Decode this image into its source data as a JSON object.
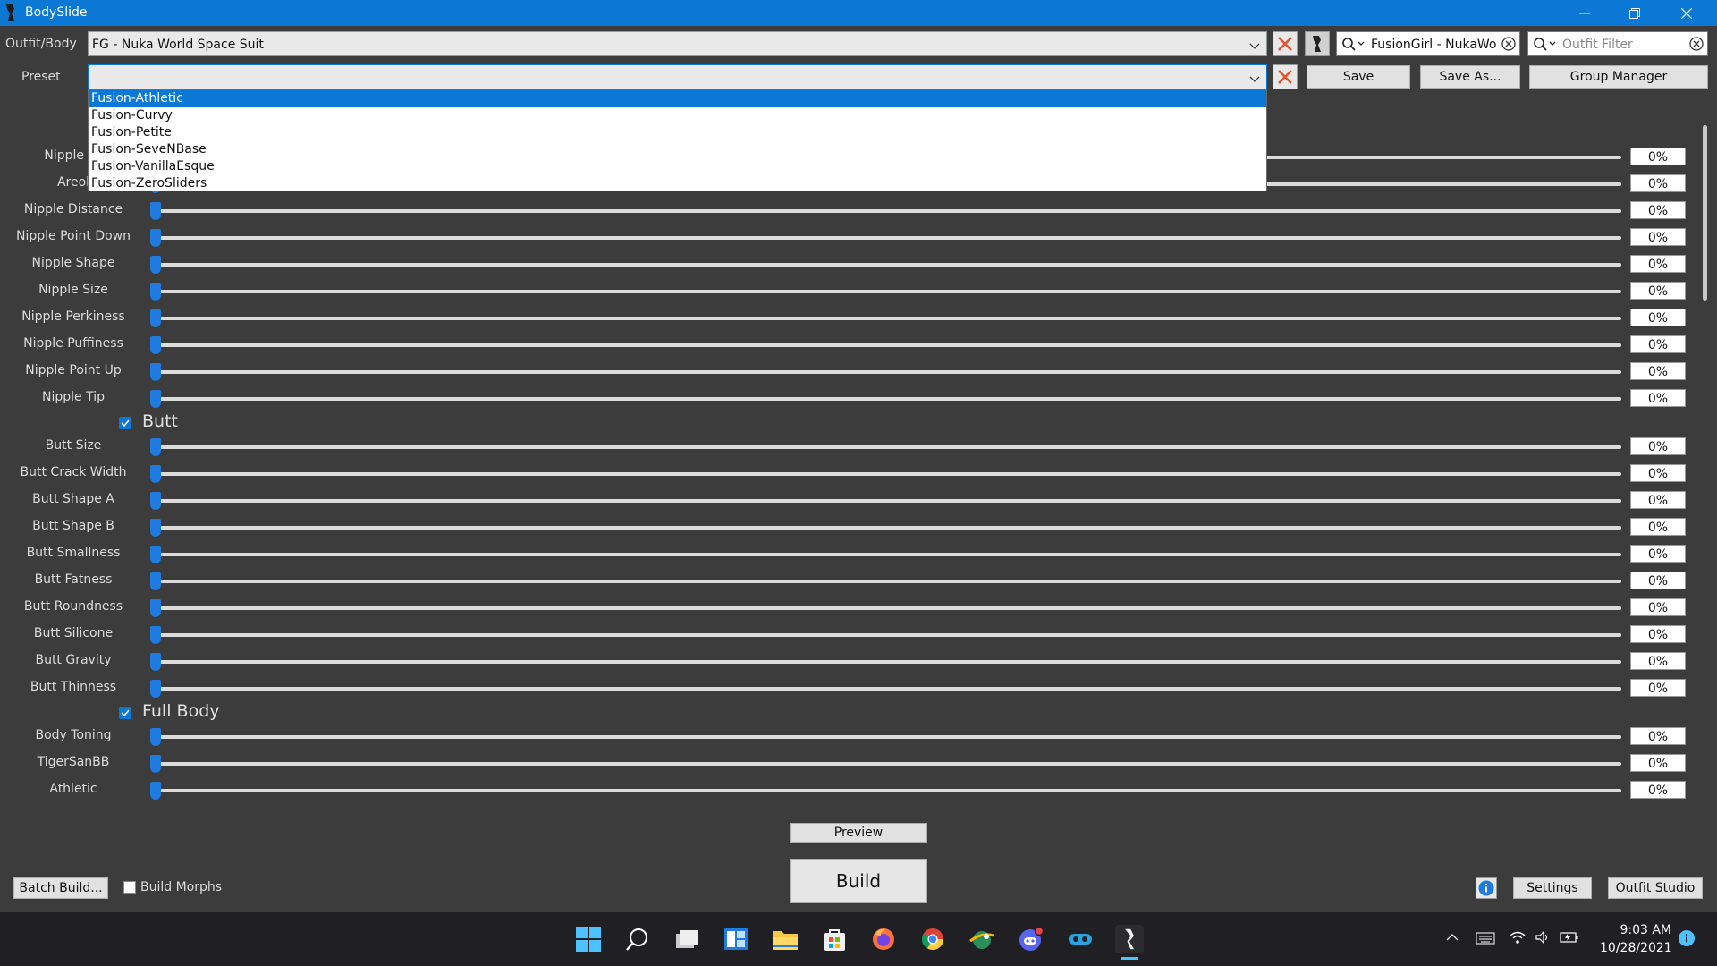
{
  "window": {
    "title": "BodySlide"
  },
  "outfit": {
    "label": "Outfit/Body",
    "value": "FG - Nuka World Space Suit",
    "group_filter": "FusionGirl - NukaWo",
    "outfit_filter_placeholder": "Outfit Filter"
  },
  "preset": {
    "label": "Preset",
    "value": "",
    "save_label": "Save",
    "save_as_label": "Save As...",
    "group_manager_label": "Group Manager",
    "options": [
      "Fusion-Athletic",
      "Fusion-Curvy",
      "Fusion-Petite",
      "Fusion-SeveNBase",
      "Fusion-VanillaEsque",
      "Fusion-ZeroSliders"
    ],
    "selected_index": 0
  },
  "sliders": {
    "partial_rows": [
      {
        "name": "Nipple Le",
        "value": "0%"
      },
      {
        "name": "Areol",
        "value": "0%"
      }
    ],
    "nipple": [
      {
        "name": "Nipple Distance",
        "value": "0%"
      },
      {
        "name": "Nipple Point Down",
        "value": "0%"
      },
      {
        "name": "Nipple Shape",
        "value": "0%"
      },
      {
        "name": "Nipple Size",
        "value": "0%"
      },
      {
        "name": "Nipple Perkiness",
        "value": "0%"
      },
      {
        "name": "Nipple Puffiness",
        "value": "0%"
      },
      {
        "name": "Nipple Point Up",
        "value": "0%"
      },
      {
        "name": "Nipple Tip",
        "value": "0%"
      }
    ],
    "butt_group": "Butt",
    "butt": [
      {
        "name": "Butt Size",
        "value": "0%"
      },
      {
        "name": "Butt Crack Width",
        "value": "0%"
      },
      {
        "name": "Butt Shape A",
        "value": "0%"
      },
      {
        "name": "Butt Shape B",
        "value": "0%"
      },
      {
        "name": "Butt Smallness",
        "value": "0%"
      },
      {
        "name": "Butt Fatness",
        "value": "0%"
      },
      {
        "name": "Butt Roundness",
        "value": "0%"
      },
      {
        "name": "Butt Silicone",
        "value": "0%"
      },
      {
        "name": "Butt Gravity",
        "value": "0%"
      },
      {
        "name": "Butt Thinness",
        "value": "0%"
      }
    ],
    "fullbody_group": "Full Body",
    "fullbody": [
      {
        "name": "Body Toning",
        "value": "0%"
      },
      {
        "name": "TigerSanBB",
        "value": "0%"
      },
      {
        "name": "Athletic",
        "value": "0%"
      }
    ]
  },
  "bottom": {
    "preview_label": "Preview",
    "build_label": "Build",
    "batch_build_label": "Batch Build...",
    "build_morphs_label": "Build Morphs",
    "settings_label": "Settings",
    "outfit_studio_label": "Outfit Studio"
  },
  "taskbar": {
    "time": "9:03 AM",
    "date": "10/28/2021"
  },
  "colors": {
    "accent": "#0a78d4",
    "background": "#3c3c3c",
    "taskbar": "#202024",
    "clear_x": "#e0552f"
  }
}
